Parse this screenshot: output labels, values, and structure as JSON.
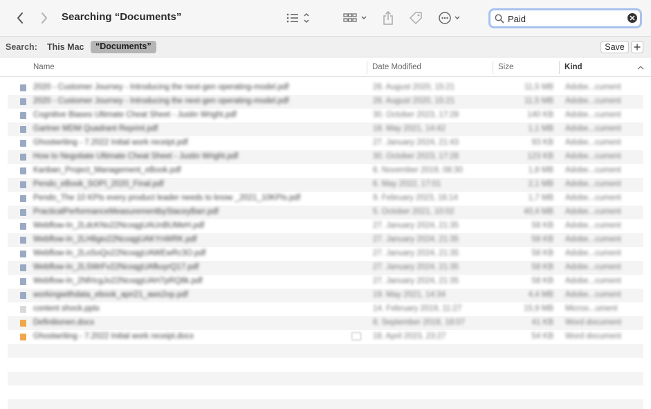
{
  "window": {
    "title": "Searching “Documents”"
  },
  "search": {
    "value": "Paid"
  },
  "scope": {
    "label": "Search:",
    "this_mac": "This Mac",
    "documents": "“Documents”",
    "save": "Save"
  },
  "columns": {
    "name": "Name",
    "date": "Date Modified",
    "size": "Size",
    "kind": "Kind"
  },
  "colors": {
    "accent": "#a8c2ee",
    "pdf_icon": "#9aa9c4",
    "word_icon": "#f0a64a",
    "ppt_icon": "#d9d9d9"
  },
  "files": [
    {
      "name": "2020 - Customer Journey - Introducing the next-gen operating-model.pdf",
      "date": "28. August 2020, 15:21",
      "size": "11,5 MB",
      "kind": "Adobe...cument",
      "icon": "pdf-icon"
    },
    {
      "name": "2020 - Customer Journey - Introducing the next-gen operating-model.pdf",
      "date": "28. August 2020, 15:21",
      "size": "11,5 MB",
      "kind": "Adobe...cument",
      "icon": "pdf-icon"
    },
    {
      "name": "Cognitive Biases Ultimate Cheat Sheet - Justin Wright.pdf",
      "date": "30. October 2023, 17:28",
      "size": "140 KB",
      "kind": "Adobe...cument",
      "icon": "pdf-icon"
    },
    {
      "name": "Gartner MDM Quadrant Reprint.pdf",
      "date": "18. May 2021, 14:42",
      "size": "1,1 MB",
      "kind": "Adobe...cument",
      "icon": "pdf-icon"
    },
    {
      "name": "Ghostwriting - 7.2022 Initial work receipt.pdf",
      "date": "27. January 2024, 21:43",
      "size": "93 KB",
      "kind": "Adobe...cument",
      "icon": "pdf-icon"
    },
    {
      "name": "How to Negotiate Ultimate Cheat Sheet - Justin Wright.pdf",
      "date": "30. October 2023, 17:28",
      "size": "123 KB",
      "kind": "Adobe...cument",
      "icon": "pdf-icon"
    },
    {
      "name": "Kanban_Project_Management_eBook.pdf",
      "date": "6. November 2019, 08:30",
      "size": "1,8 MB",
      "kind": "Adobe...cument",
      "icon": "pdf-icon"
    },
    {
      "name": "Pendo_eBook_SOPI_2020_Final.pdf",
      "date": "6. May 2022, 17:01",
      "size": "2,1 MB",
      "kind": "Adobe...cument",
      "icon": "pdf-icon"
    },
    {
      "name": "Pendo_The 10 KPIs every product leader needs to know _2021_10KPIs.pdf",
      "date": "9. February 2023, 16:14",
      "size": "1,7 MB",
      "kind": "Adobe...cument",
      "icon": "pdf-icon"
    },
    {
      "name": "PracticalPerformanceMeasurementbyStaceyBarr.pdf",
      "date": "5. October 2021, 10:02",
      "size": "40,4 MB",
      "kind": "Adobe...cument",
      "icon": "pdf-icon"
    },
    {
      "name": "Webflow-In_2LdcKNo22NcoqgUAUnBUMeH.pdf",
      "date": "27. January 2024, 21:35",
      "size": "58 KB",
      "kind": "Adobe...cument",
      "icon": "pdf-icon"
    },
    {
      "name": "Webflow-In_2LH8gio22NcoqgUAKYnWRK.pdf",
      "date": "27. January 2024, 21:35",
      "size": "58 KB",
      "kind": "Adobe...cument",
      "icon": "pdf-icon"
    },
    {
      "name": "Webflow-In_2LoSoQo22NcoqgUAWEwRc3O.pdf",
      "date": "27. January 2024, 21:35",
      "size": "58 KB",
      "kind": "Adobe...cument",
      "icon": "pdf-icon"
    },
    {
      "name": "Webflow-In_2LSWrFv22NcoqgUAfkuyrQ17.pdf",
      "date": "27. January 2024, 21:35",
      "size": "58 KB",
      "kind": "Adobe...cument",
      "icon": "pdf-icon"
    },
    {
      "name": "Webflow-In_2NfrIcgJo22NcoqgUAH7pRQ8k.pdf",
      "date": "27. January 2024, 21:35",
      "size": "58 KB",
      "kind": "Adobe...cument",
      "icon": "pdf-icon"
    },
    {
      "name": "workingwithdata_ebook_apri21_aws2op.pdf",
      "date": "19. May 2021, 14:34",
      "size": "4,4 MB",
      "kind": "Adobe...cument",
      "icon": "pdf-icon"
    },
    {
      "name": "content shock.pptx",
      "date": "14. February 2019, 11:27",
      "size": "15,9 MB",
      "kind": "Micros...ument",
      "icon": "pptx-icon"
    },
    {
      "name": "Definitionen.docx",
      "date": "8. September 2018, 18:07",
      "size": "41 KB",
      "kind": "Word document",
      "icon": "docx-icon"
    },
    {
      "name": "Ghostwriting - 7.2022 Initial work receipt.docx",
      "date": "18. April 2023, 23:27",
      "size": "54 KB",
      "kind": "Word document",
      "icon": "docx-icon"
    }
  ]
}
